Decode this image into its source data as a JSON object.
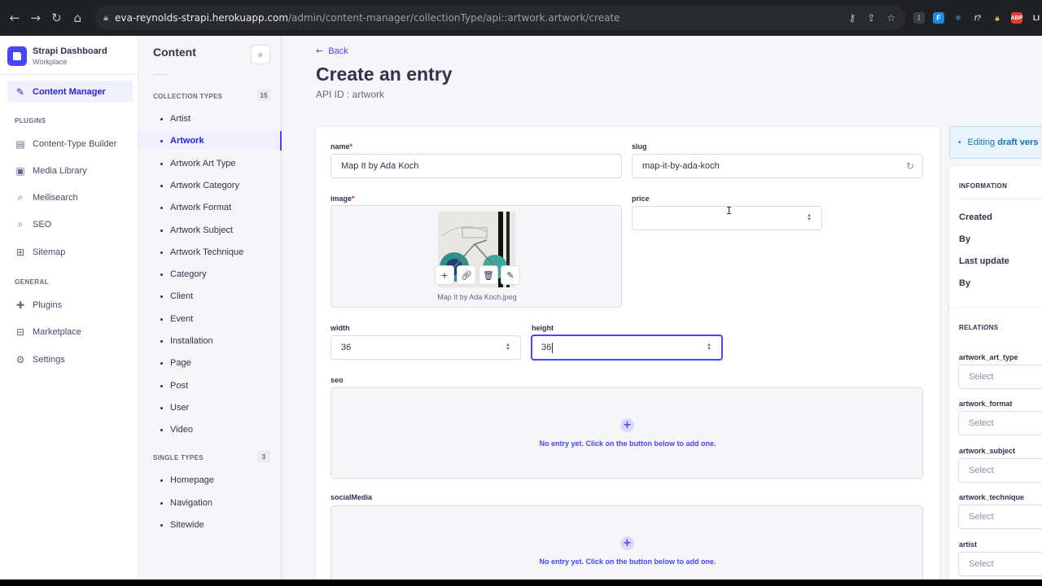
{
  "browser": {
    "url_host": "eva-reynolds-strapi.herokuapp.com",
    "url_path": "/admin/content-manager/collectionType/api::artwork.artwork/create"
  },
  "brand": {
    "title": "Strapi Dashboard",
    "subtitle": "Workplace"
  },
  "mainnav": {
    "content_manager": "Content Manager",
    "plugins_header": "PLUGINS",
    "plugins": [
      {
        "label": "Content-Type Builder",
        "icon": "builder-icon"
      },
      {
        "label": "Media Library",
        "icon": "media-icon"
      },
      {
        "label": "Meilisearch",
        "icon": "search-icon"
      },
      {
        "label": "SEO",
        "icon": "seo-icon"
      },
      {
        "label": "Sitemap",
        "icon": "sitemap-icon"
      }
    ],
    "general_header": "GENERAL",
    "general": [
      {
        "label": "Plugins",
        "icon": "puzzle-icon"
      },
      {
        "label": "Marketplace",
        "icon": "cart-icon"
      },
      {
        "label": "Settings",
        "icon": "gear-icon"
      }
    ]
  },
  "subnav": {
    "title": "Content",
    "collection_header": "COLLECTION TYPES",
    "collection_count": "15",
    "collection_items": [
      "Artist",
      "Artwork",
      "Artwork Art Type",
      "Artwork Category",
      "Artwork Format",
      "Artwork Subject",
      "Artwork Technique",
      "Category",
      "Client",
      "Event",
      "Installation",
      "Page",
      "Post",
      "User",
      "Video"
    ],
    "active_index": 1,
    "single_header": "SINGLE TYPES",
    "single_count": "3",
    "single_items": [
      "Homepage",
      "Navigation",
      "Sitewide"
    ]
  },
  "page": {
    "back": "Back",
    "title": "Create an entry",
    "api_id": "API ID : artwork"
  },
  "form": {
    "name_label": "name",
    "name_value": "Map It by Ada Koch",
    "slug_label": "slug",
    "slug_value": "map-it-by-ada-koch",
    "image_label": "image",
    "image_caption": "Map It by Ada Koch.jpeg",
    "price_label": "price",
    "price_value": "",
    "width_label": "width",
    "width_value": "36",
    "height_label": "height",
    "height_value": "36",
    "seo_label": "seo",
    "seo_empty": "No entry yet. Click on the button below to add one.",
    "social_label": "socialMedia",
    "social_empty": "No entry yet. Click on the button below to add one."
  },
  "side": {
    "draft_prefix": "Editing ",
    "draft_bold": "draft vers",
    "information_header": "INFORMATION",
    "info_rows": [
      "Created",
      "By",
      "Last update",
      "By"
    ],
    "relations_header": "RELATIONS",
    "relations": [
      {
        "label": "artwork_art_type",
        "placeholder": "Select"
      },
      {
        "label": "artwork_format",
        "placeholder": "Select"
      },
      {
        "label": "artwork_subject",
        "placeholder": "Select"
      },
      {
        "label": "artwork_technique",
        "placeholder": "Select"
      },
      {
        "label": "artist",
        "placeholder": "Select"
      }
    ]
  },
  "colors": {
    "primary": "#4945ff",
    "active_text": "#271fe0",
    "required": "#d02b20"
  }
}
